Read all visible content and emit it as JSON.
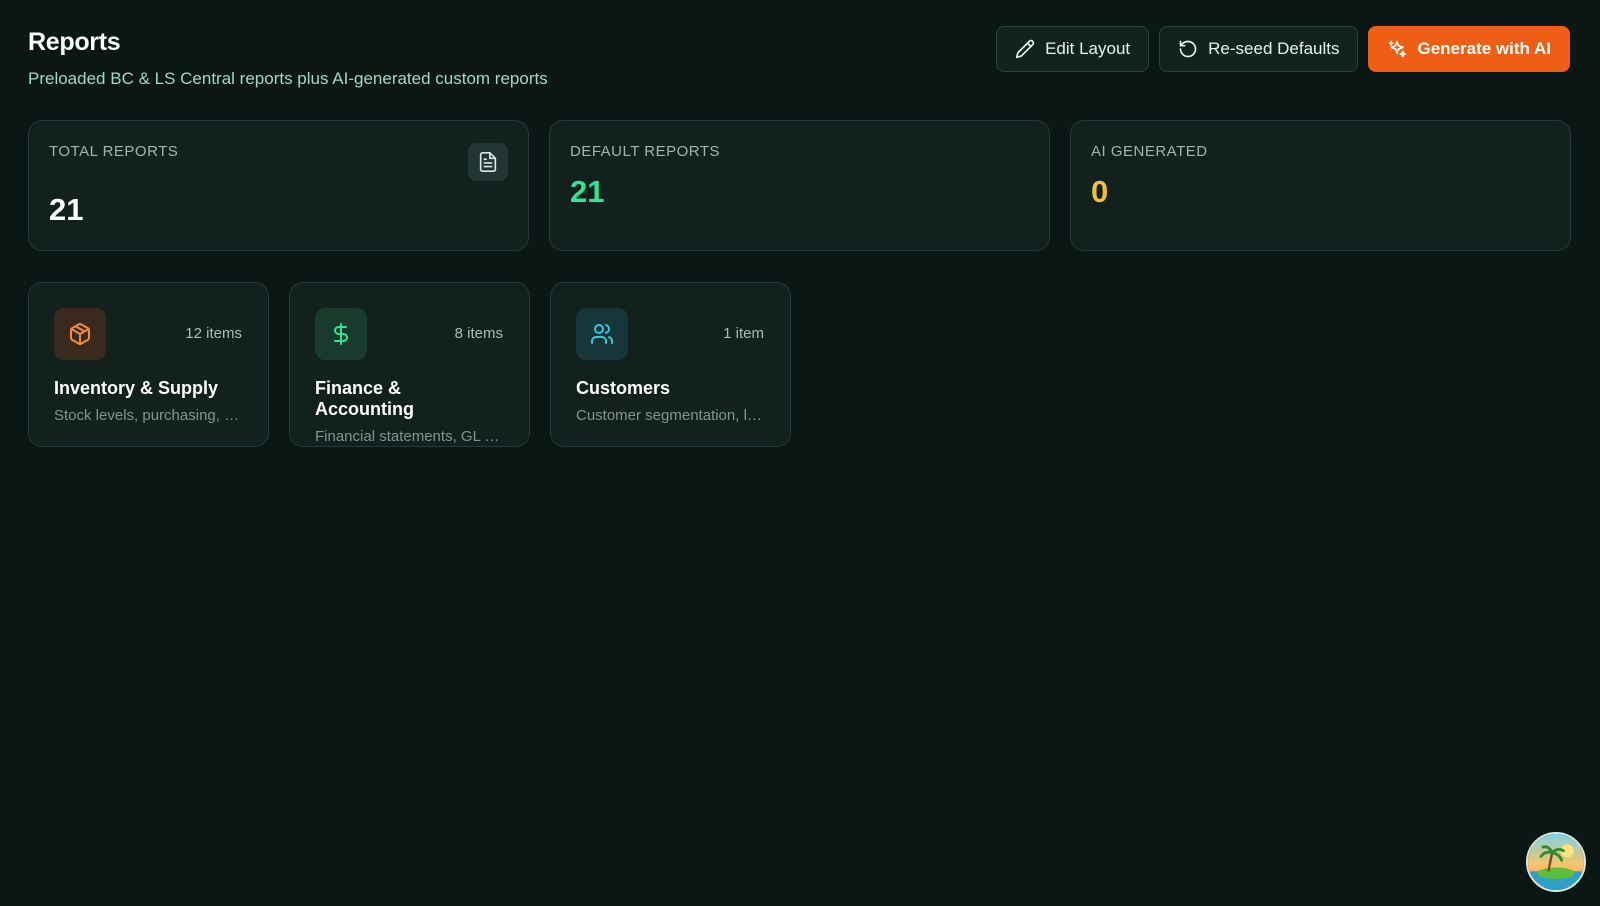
{
  "header": {
    "title": "Reports",
    "subtitle": "Preloaded BC & LS Central reports plus AI-generated custom reports"
  },
  "actions": {
    "edit_layout": "Edit Layout",
    "reseed_defaults": "Re-seed Defaults",
    "generate_ai": "Generate with AI"
  },
  "stats": [
    {
      "label": "TOTAL REPORTS",
      "value": "21",
      "icon": "document-icon"
    },
    {
      "label": "DEFAULT REPORTS",
      "value": "21"
    },
    {
      "label": "AI GENERATED",
      "value": "0"
    }
  ],
  "categories": [
    {
      "title": "Inventory & Supply",
      "count": "12 items",
      "description": "Stock levels, purchasing, suppliers and more",
      "icon": "box-icon"
    },
    {
      "title": "Finance & Accounting",
      "count": "8 items",
      "description": "Financial statements, GL entries and more",
      "icon": "dollar-icon"
    },
    {
      "title": "Customers",
      "count": "1 item",
      "description": "Customer segmentation, loyalty and more",
      "icon": "users-icon"
    }
  ],
  "colors": {
    "background": "#0a1714",
    "card": "#13211e",
    "accent_orange": "#ee5e14",
    "value_green": "#2ee592",
    "value_yellow": "#f5c030"
  }
}
